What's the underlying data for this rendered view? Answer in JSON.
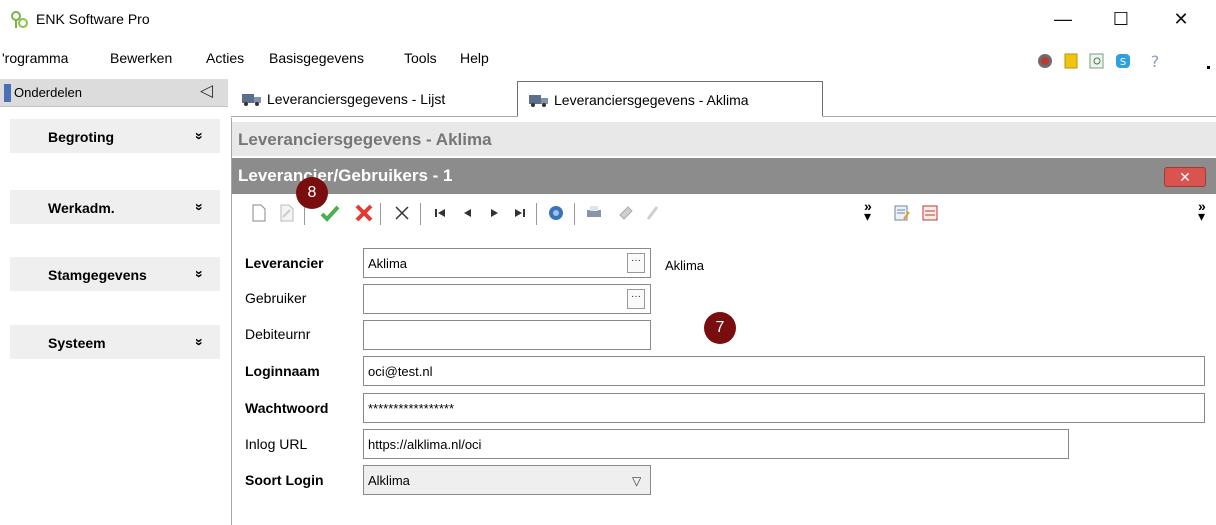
{
  "window": {
    "title": "ENK Software Pro",
    "controls": {
      "minimize": "—",
      "maximize": "☐",
      "close": "✕"
    }
  },
  "menu": {
    "items": [
      "'rogramma",
      "Bewerken",
      "Acties",
      "Basisgegevens",
      "Tools",
      "Help"
    ],
    "right_icons": [
      "globe-icon",
      "notebook-icon",
      "find-icon",
      "skype-icon",
      "help-icon"
    ]
  },
  "nav": {
    "header": "Onderdelen",
    "collapse_icon": "◁",
    "groups": [
      {
        "label": "Begroting",
        "chevron": "»"
      },
      {
        "label": "Werkadm.",
        "chevron": "»"
      },
      {
        "label": "Stamgegevens",
        "chevron": "»"
      },
      {
        "label": "Systeem",
        "chevron": "»"
      }
    ]
  },
  "tabs": [
    {
      "label": "Leveranciersgegevens - Lijst",
      "active": false
    },
    {
      "label": "Leveranciersgegevens - Aklima",
      "active": true
    }
  ],
  "page": {
    "title": "Leveranciersgegevens - Aklima",
    "subpanel_title": "Leverancier/Gebruikers - 1",
    "close_label": "✕"
  },
  "toolbar": {
    "icons": [
      "new-icon",
      "edit-icon",
      "save-checkmark-icon",
      "cancel-x-icon",
      "delete-icon",
      "first-record-icon",
      "prev-record-icon",
      "next-record-icon",
      "last-record-icon",
      "refresh-icon",
      "print-icon",
      "link-icon",
      "attach-icon",
      "overflow-icon",
      "form-edit-icon",
      "list-icon"
    ]
  },
  "form": {
    "leverancier": {
      "label": "Leverancier",
      "value": "Aklima",
      "description": "Aklima"
    },
    "gebruiker": {
      "label": "Gebruiker",
      "value": ""
    },
    "debiteurnr": {
      "label": "Debiteurnr",
      "value": ""
    },
    "loginnaam": {
      "label": "Loginnaam",
      "value": "oci@test.nl"
    },
    "wachtwoord": {
      "label": "Wachtwoord",
      "value": "*****************"
    },
    "inlog_url": {
      "label": "Inlog URL",
      "value": "https://alklima.nl/oci"
    },
    "soort_login": {
      "label": "Soort Login",
      "value": "Alklima"
    }
  },
  "badges": {
    "step_7": "7",
    "step_8": "8"
  },
  "colors": {
    "badge": "#7a0e0e",
    "subpanel": "#8c8c8c",
    "close": "#d9534f"
  }
}
